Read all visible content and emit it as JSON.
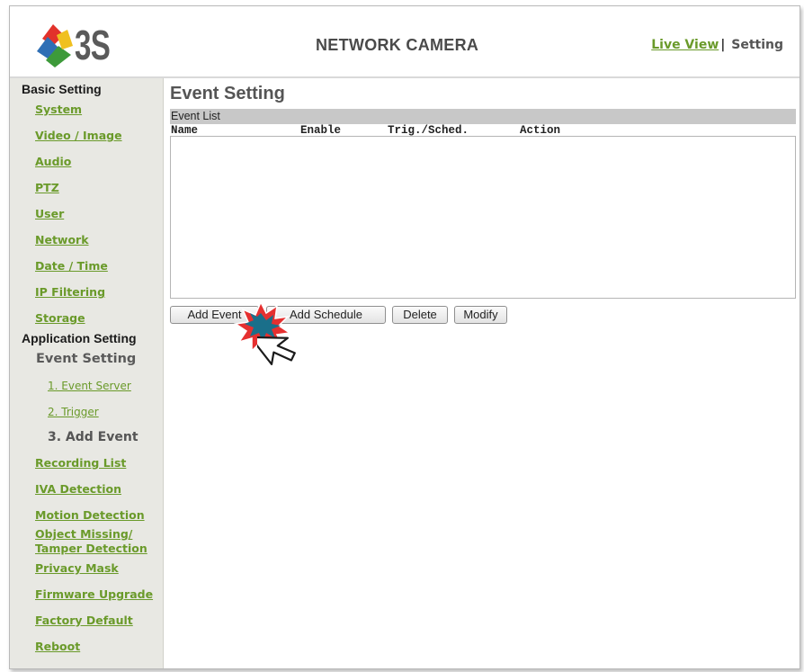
{
  "header": {
    "logo_text": "3S",
    "app_title": "NETWORK CAMERA",
    "live_view": "Live View",
    "separator": "|",
    "setting": "Setting"
  },
  "sidebar": {
    "basic_title": "Basic Setting",
    "basic_links": [
      "System",
      "Video / Image",
      "Audio",
      "PTZ",
      "User",
      "Network",
      "Date / Time",
      "IP Filtering",
      "Storage"
    ],
    "app_title": "Application Setting",
    "event_setting": "Event Setting",
    "event_sub": [
      "1. Event Server",
      "2. Trigger"
    ],
    "event_current": "3. Add Event",
    "app_links": [
      "Recording List",
      "IVA Detection",
      "Motion Detection",
      "Object Missing/",
      "Tamper Detection",
      "Privacy Mask",
      "Firmware Upgrade",
      "Factory Default",
      "Reboot"
    ]
  },
  "main": {
    "title": "Event Setting",
    "list_title": "Event List",
    "columns": [
      "Name",
      "Enable",
      "Trig./Sched.",
      "Action"
    ],
    "buttons": {
      "add_event": "Add Event",
      "add_schedule": "Add Schedule",
      "delete": "Delete",
      "modify": "Modify"
    }
  },
  "colors": {
    "link": "#6a9a2a",
    "sidebar_bg": "#e8e8e3",
    "list_bar": "#c8c8c8",
    "click_burst": "#e53030"
  }
}
